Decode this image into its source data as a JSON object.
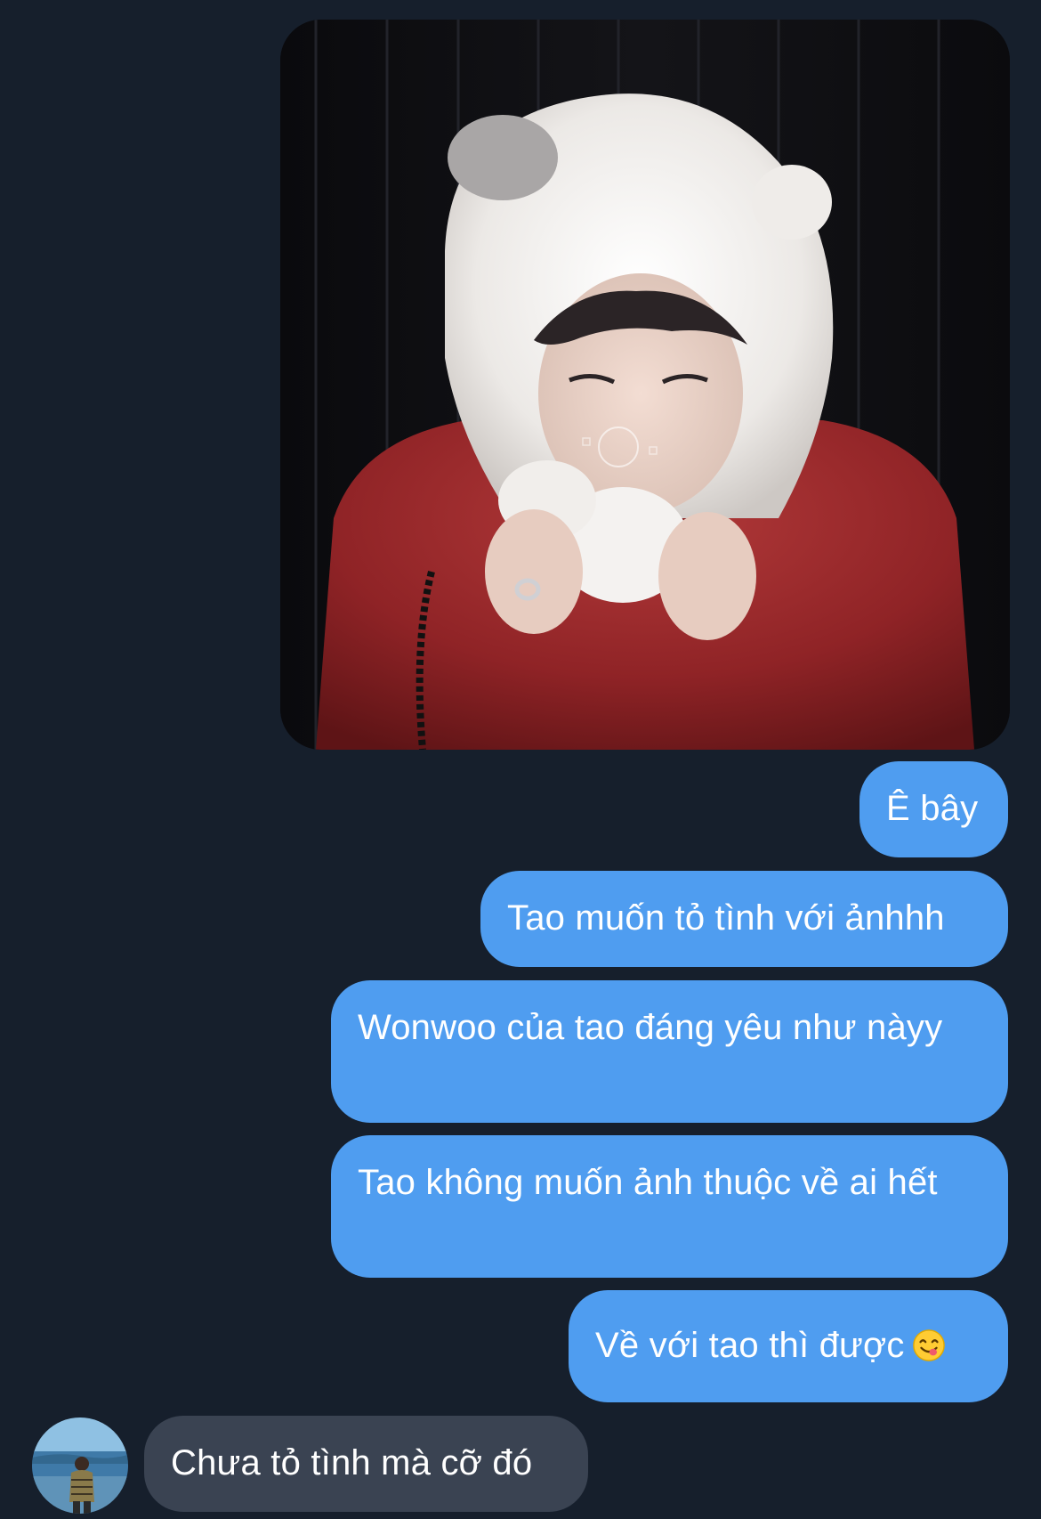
{
  "conversation": {
    "photo": {
      "alt": "sent-photo",
      "icon": "photo-image"
    },
    "messages": [
      {
        "direction": "sent",
        "text": "Ê bây"
      },
      {
        "direction": "sent",
        "text": "Tao muốn tỏ tình với ảnhhh"
      },
      {
        "direction": "sent",
        "text": "Wonwoo của tao đáng yêu như nàyy"
      },
      {
        "direction": "sent",
        "text": "Tao không muốn ảnh thuộc về ai hết"
      },
      {
        "direction": "sent",
        "text": "Về với tao thì được",
        "emoji": "face-savoring-food-icon"
      },
      {
        "direction": "received",
        "text": "Chưa tỏ tình mà cỡ đó"
      }
    ],
    "avatar": {
      "icon": "contact-avatar"
    }
  },
  "colors": {
    "background": "#161f2c",
    "sent_bubble": "#4f9df0",
    "received_bubble": "#3a4352",
    "text": "#ffffff"
  }
}
